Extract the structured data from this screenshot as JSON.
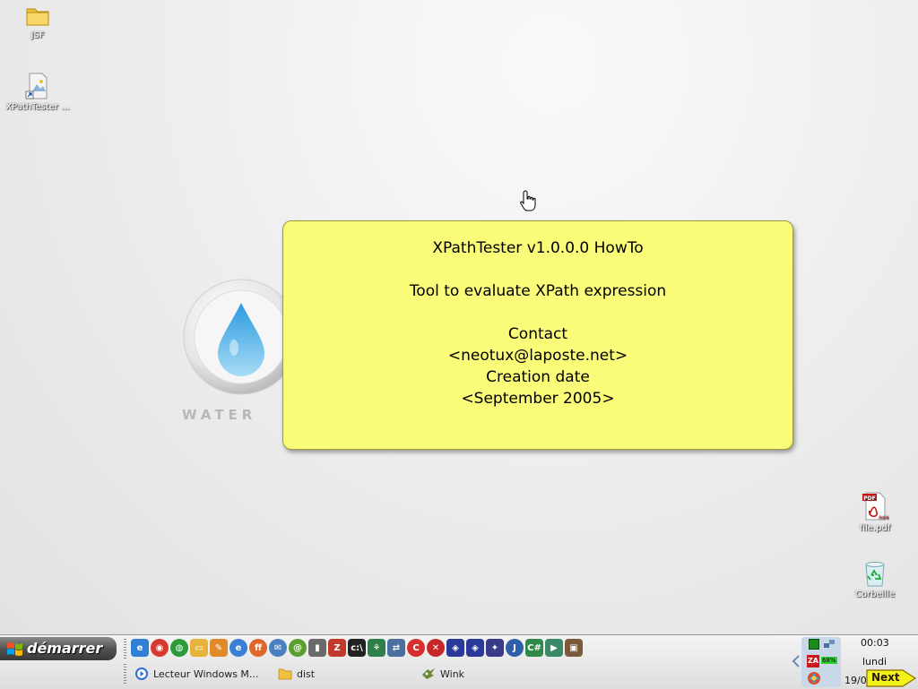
{
  "desktop": {
    "icons": [
      {
        "label": "JSF",
        "icon": "folder-icon"
      },
      {
        "label": "XPathTester ...",
        "icon": "shortcut-image-icon"
      },
      {
        "label": "file.pdf",
        "icon": "pdf-icon"
      },
      {
        "label": "Corbeille",
        "icon": "recycle-bin-icon"
      }
    ],
    "wallpaper_text": "WATER"
  },
  "note": {
    "title": "XPathTester v1.0.0.0 HowTo",
    "description": "Tool to evaluate XPath expression",
    "contact_label": "Contact",
    "contact_email": "<neotux@laposte.net>",
    "date_label": "Creation date",
    "date_value": "<September 2005>",
    "colors": {
      "background": "#fbfb7a",
      "border": "#9a9a3a"
    }
  },
  "taskbar": {
    "start_label": "démarrer",
    "quick_launch": [
      "ie-icon",
      "chrome-like-icon",
      "globe-icon",
      "folder-icon",
      "pencil-icon",
      "ie-icon",
      "firefox-icon",
      "mail-icon",
      "at-icon",
      "book-icon",
      "filezilla-icon",
      "console-icon",
      "tree-icon",
      "network-icon",
      "c-icon",
      "stop-icon",
      "cube-icon",
      "cube-icon",
      "tool-icon",
      "j-icon",
      "csharp-icon",
      "play-icon",
      "app-icon"
    ],
    "tasks": [
      {
        "label": "Lecteur Windows M...",
        "icon": "media-player-icon"
      },
      {
        "label": "dist",
        "icon": "folder-icon"
      },
      {
        "label": "Wink",
        "icon": "wink-icon"
      }
    ],
    "tray": {
      "time": "00:03",
      "day": "lundi",
      "date": "19/0",
      "battery": "68%",
      "next_label": "Next"
    }
  }
}
